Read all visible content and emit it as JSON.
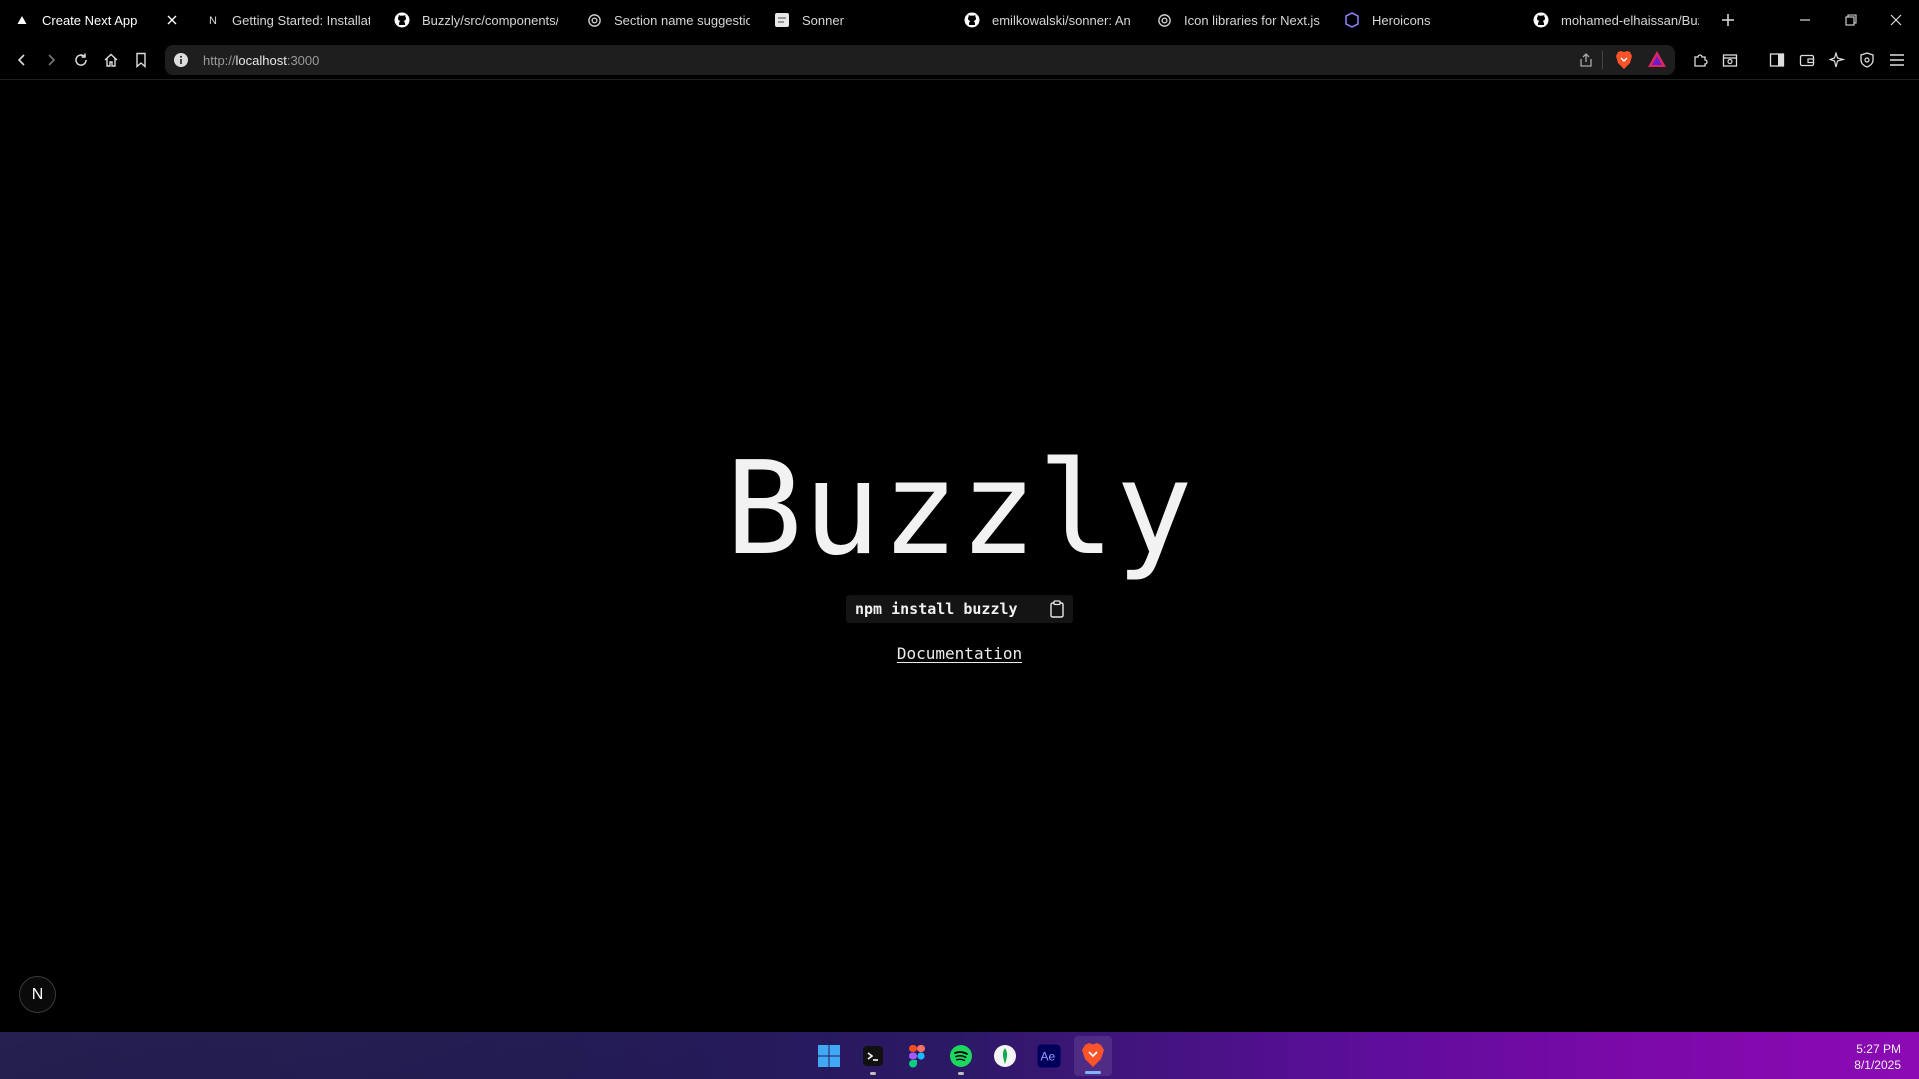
{
  "browser": {
    "tabs": [
      {
        "title": "Create Next App",
        "favicon": "nextjs-triangle-icon",
        "active": true
      },
      {
        "title": "Getting Started: Installatio",
        "favicon": "notion-n-icon"
      },
      {
        "title": "Buzzly/src/components/W",
        "favicon": "github-icon"
      },
      {
        "title": "Section name suggestion",
        "favicon": "chatgpt-icon"
      },
      {
        "title": "Sonner",
        "favicon": "sonner-icon"
      },
      {
        "title": "emilkowalski/sonner: An o",
        "favicon": "github-icon"
      },
      {
        "title": "Icon libraries for Next.js",
        "favicon": "chatgpt-icon"
      },
      {
        "title": "Heroicons",
        "favicon": "heroicons-icon"
      },
      {
        "title": "mohamed-elhaissan/Buzz",
        "favicon": "github-icon"
      }
    ],
    "address": {
      "scheme": "http://",
      "host": "localhost",
      "port": ":3000"
    }
  },
  "page": {
    "title": "Buzzly",
    "install_command": "npm install buzzly",
    "doc_link": "Documentation",
    "dev_badge": "N"
  },
  "taskbar": {
    "apps": [
      "windows-start-icon",
      "terminal-icon",
      "figma-icon",
      "spotify-icon",
      "mongodb-compass-icon",
      "after-effects-icon",
      "brave-icon"
    ],
    "ae_label": "Ae",
    "time": "5:27 PM",
    "date": "8/1/2025"
  },
  "colors": {
    "accent": "#7b09a9",
    "brave": "#fb542b",
    "spotify": "#1ed760"
  }
}
